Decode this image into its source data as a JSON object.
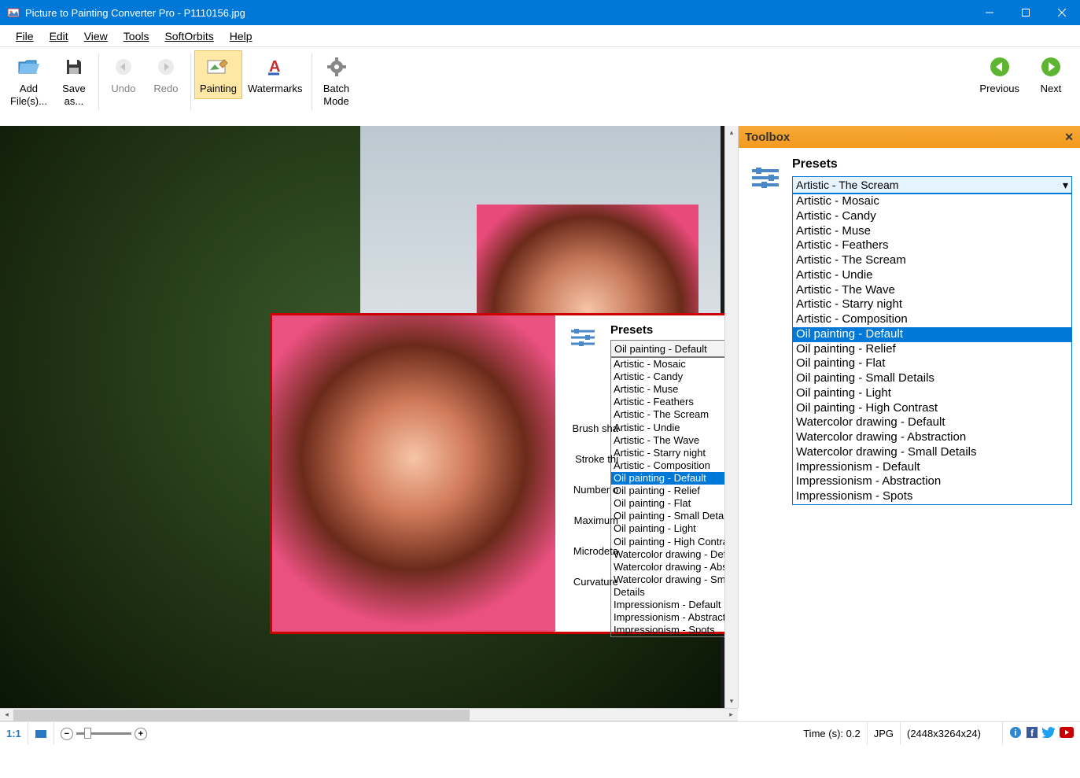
{
  "window": {
    "title": "Picture to Painting Converter Pro - P1110156.jpg"
  },
  "menu": [
    {
      "label": "File",
      "hotkey_index": 0
    },
    {
      "label": "Edit",
      "hotkey_index": 0
    },
    {
      "label": "View",
      "hotkey_index": 0
    },
    {
      "label": "Tools",
      "hotkey_index": 0
    },
    {
      "label": "SoftOrbits",
      "hotkey_index": 0
    },
    {
      "label": "Help",
      "hotkey_index": 0
    }
  ],
  "toolbar": {
    "add_files": "Add\nFile(s)...",
    "save_as": "Save\nas...",
    "undo": "Undo",
    "redo": "Redo",
    "painting": "Painting",
    "watermarks": "Watermarks",
    "batch_mode": "Batch\nMode",
    "previous": "Previous",
    "next": "Next"
  },
  "toolbox": {
    "title": "Toolbox",
    "presets_label": "Presets",
    "selected": "Artistic - The Scream",
    "highlighted": "Oil painting - Default",
    "items": [
      "Artistic - Mosaic",
      "Artistic - Candy",
      "Artistic - Muse",
      "Artistic - Feathers",
      "Artistic - The Scream",
      "Artistic - Undie",
      "Artistic - The Wave",
      "Artistic - Starry night",
      "Artistic - Composition",
      "Oil painting - Default",
      "Oil painting - Relief",
      "Oil painting - Flat",
      "Oil painting - Small Details",
      "Oil painting - Light",
      "Oil painting - High Contrast",
      "Watercolor drawing - Default",
      "Watercolor drawing - Abstraction",
      "Watercolor drawing - Small Details",
      "Impressionism - Default",
      "Impressionism - Abstraction",
      "Impressionism - Spots"
    ]
  },
  "inset": {
    "presets_label": "Presets",
    "selected": "Oil painting - Default",
    "highlighted": "Oil painting - Default",
    "items": [
      "Artistic - Mosaic",
      "Artistic - Candy",
      "Artistic - Muse",
      "Artistic - Feathers",
      "Artistic - The Scream",
      "Artistic - Undie",
      "Artistic - The Wave",
      "Artistic - Starry night",
      "Artistic - Composition",
      "Oil painting - Default",
      "Oil painting - Relief",
      "Oil painting - Flat",
      "Oil painting - Small Details",
      "Oil painting - Light",
      "Oil painting - High Contrast",
      "Watercolor drawing - Default",
      "Watercolor drawing - Abstraction",
      "Watercolor drawing - Small Details",
      "Impressionism - Default",
      "Impressionism - Abstraction",
      "Impressionism - Spots"
    ],
    "slider_labels": {
      "brush_shape": "Brush sha",
      "stroke_thickness": "Stroke thi",
      "number": "Number o",
      "maximum": "Maximum",
      "microdetail": "Microdeta",
      "curvature": "Curvature"
    }
  },
  "status": {
    "zoom_label": "1:1",
    "time": "Time (s): 0.2",
    "format": "JPG",
    "dimensions": "(2448x3264x24)"
  }
}
